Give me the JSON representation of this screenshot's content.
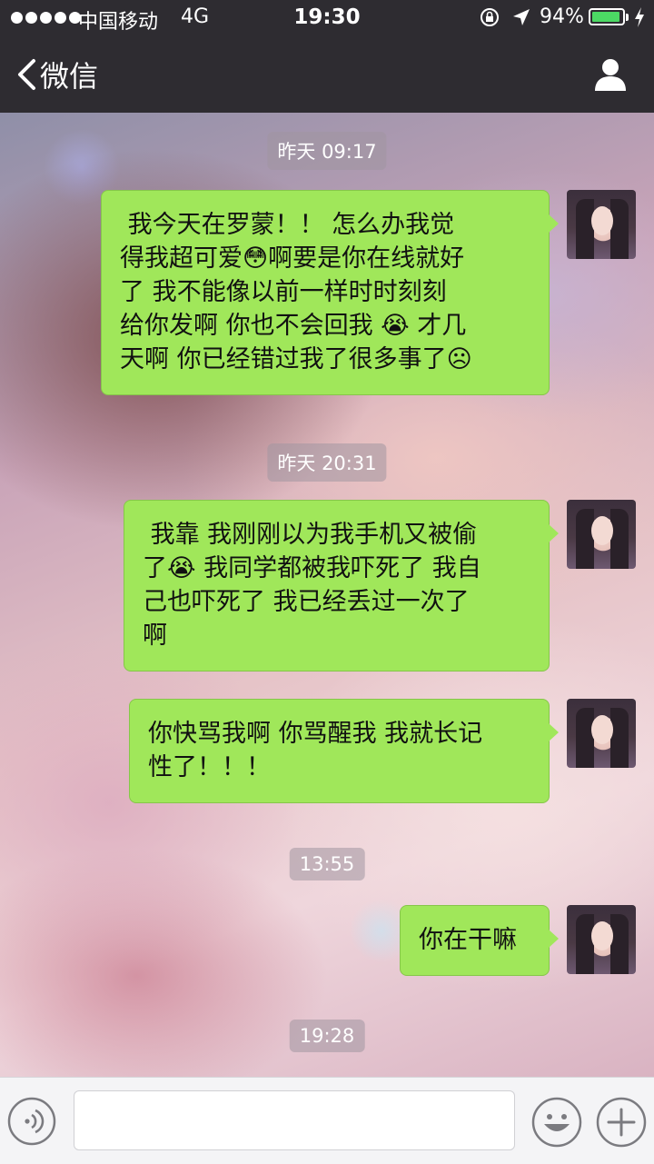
{
  "status_bar": {
    "carrier": "中国移动",
    "network": "4G",
    "time": "19:30",
    "battery_percent": "94%",
    "battery_level": 0.94,
    "battery_color": "#4cd964"
  },
  "nav": {
    "back_label": "微信",
    "back_icon": "chevron-left-icon",
    "profile_icon": "person-icon"
  },
  "chat": {
    "timestamps": [
      "昨天 09:17",
      "昨天 20:31",
      "13:55",
      "19:28"
    ],
    "messages": [
      {
        "lines": [
          " 我今天在罗蒙！！ 怎么办我觉",
          "得我超可爱😳啊要是你在线就好",
          "了 我不能像以前一样时时刻刻",
          "给你发啊 你也不会回我 😭 才几",
          "天啊 你已经错过我了很多事了☹"
        ]
      },
      {
        "lines": [
          " 我靠 我刚刚以为我手机又被偷",
          "了😭 我同学都被我吓死了 我自",
          "己也吓死了 我已经丢过一次了",
          "啊"
        ]
      },
      {
        "lines": [
          "你快骂我啊 你骂醒我 我就长记",
          "性了！！！"
        ]
      },
      {
        "lines": [
          "你在干嘛"
        ]
      }
    ],
    "bubble_color": "#a0e75a"
  },
  "input_bar": {
    "voice_icon": "voice-icon",
    "emoji_icon": "emoji-icon",
    "plus_icon": "plus-icon",
    "text_value": ""
  }
}
